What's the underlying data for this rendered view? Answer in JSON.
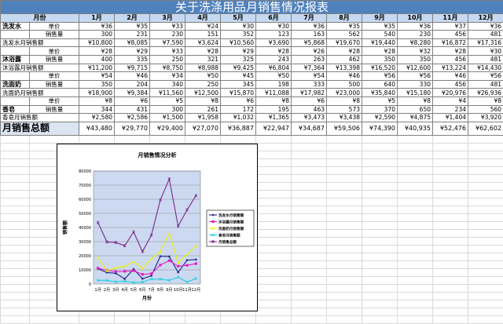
{
  "title": "关于洗涤用品月销售情况报表",
  "header": {
    "category_label": "月份",
    "months": [
      "1月",
      "2月",
      "3月",
      "4月",
      "5月",
      "6月",
      "7月",
      "8月",
      "9月",
      "10月",
      "11月",
      "12月"
    ]
  },
  "rows": [
    {
      "cat": "洗发水",
      "label": "单价",
      "values": [
        "¥36",
        "¥35",
        "¥33",
        "¥24",
        "¥30",
        "¥30",
        "¥36",
        "¥35",
        "¥35",
        "¥36",
        "¥37",
        "¥36"
      ]
    },
    {
      "cat": "",
      "label": "销售量",
      "values": [
        "300",
        "231",
        "230",
        "151",
        "352",
        "123",
        "163",
        "562",
        "540",
        "230",
        "456",
        "481"
      ]
    },
    {
      "cat": "",
      "label": "洗发水月销售额",
      "values": [
        "¥10,800",
        "¥8,085",
        "¥7,590",
        "¥3,624",
        "¥10,560",
        "¥3,690",
        "¥5,868",
        "¥19,670",
        "¥19,440",
        "¥8,280",
        "¥16,872",
        "¥17,316"
      ],
      "full": true
    },
    {
      "cat": "",
      "label": "单价",
      "values": [
        "¥28",
        "¥29",
        "¥33",
        "¥28",
        "¥29",
        "¥28",
        "¥26",
        "¥28",
        "¥28",
        "¥32",
        "¥28",
        "¥30"
      ]
    },
    {
      "cat": "沐浴露",
      "label": "销售量",
      "values": [
        "400",
        "335",
        "250",
        "321",
        "325",
        "243",
        "263",
        "462",
        "350",
        "350",
        "456",
        "481"
      ]
    },
    {
      "cat": "",
      "label": "沐浴露月销售额",
      "values": [
        "¥11,200",
        "¥9,715",
        "¥8,750",
        "¥8,988",
        "¥9,425",
        "¥6,804",
        "¥7,364",
        "¥13,398",
        "¥16,520",
        "¥12,600",
        "¥13,224",
        "¥14,430"
      ],
      "full": true
    },
    {
      "cat": "",
      "label": "单价",
      "values": [
        "¥54",
        "¥46",
        "¥34",
        "¥50",
        "¥45",
        "¥50",
        "¥54",
        "¥46",
        "¥56",
        "¥56",
        "¥46",
        "¥56"
      ]
    },
    {
      "cat": "洗面奶",
      "label": "销售量",
      "values": [
        "350",
        "204",
        "340",
        "250",
        "345",
        "198",
        "333",
        "500",
        "640",
        "330",
        "456",
        "481"
      ]
    },
    {
      "cat": "",
      "label": "洗面奶月销售额",
      "values": [
        "¥18,900",
        "¥9,384",
        "¥11,560",
        "¥12,500",
        "¥15,870",
        "¥11,088",
        "¥17,982",
        "¥23,000",
        "¥35,840",
        "¥15,180",
        "¥20,976",
        "¥26,936"
      ],
      "full": true
    },
    {
      "cat": "",
      "label": "单价",
      "values": [
        "¥8",
        "¥6",
        "¥5",
        "¥8",
        "¥6",
        "¥8",
        "¥6",
        "¥8",
        "¥5",
        "¥8",
        "¥4",
        "¥8"
      ]
    },
    {
      "cat": "香皂",
      "label": "销售量",
      "values": [
        "344",
        "431",
        "300",
        "261",
        "172",
        "195",
        "463",
        "573",
        "370",
        "650",
        "234",
        "560"
      ]
    },
    {
      "cat": "",
      "label": "香皂月销售额",
      "values": [
        "¥2,580",
        "¥2,586",
        "¥1,500",
        "¥1,958",
        "¥1,032",
        "¥1,365",
        "¥3,473",
        "¥3,438",
        "¥2,590",
        "¥4,875",
        "¥1,404",
        "¥3,920"
      ],
      "full": true
    }
  ],
  "total": {
    "label": "月销售总额",
    "values": [
      "¥43,480",
      "¥29,770",
      "¥29,400",
      "¥27,070",
      "¥36,887",
      "¥22,947",
      "¥34,687",
      "¥59,506",
      "¥74,390",
      "¥40,935",
      "¥52,476",
      "¥62,602"
    ]
  },
  "colors": {
    "title_bg": "#4f81bd",
    "header_bg": "#c6d9f1",
    "plot_bg": "#ccd9f0"
  },
  "chart_data": {
    "type": "line",
    "title": "月销售情况分析",
    "xlabel": "月份",
    "ylabel": "销售额",
    "categories": [
      "1月",
      "2月",
      "3月",
      "4月",
      "5月",
      "6月",
      "7月",
      "8月",
      "9月",
      "10月",
      "11月",
      "12月"
    ],
    "ylim": [
      0,
      80000
    ],
    "yticks": [
      0,
      10000,
      20000,
      30000,
      40000,
      50000,
      60000,
      70000,
      80000
    ],
    "grid": true,
    "legend_position": "right",
    "series": [
      {
        "name": "洗发水月销售额",
        "color": "#1f1f8f",
        "marker": "diamond",
        "values": [
          10800,
          8085,
          7590,
          3624,
          10560,
          3690,
          5868,
          19670,
          19440,
          8280,
          16872,
          17316
        ]
      },
      {
        "name": "沐浴露月销售额",
        "color": "#e020c0",
        "marker": "square",
        "values": [
          11200,
          9715,
          8750,
          8988,
          9425,
          6804,
          7364,
          13398,
          16520,
          12600,
          13224,
          14430
        ]
      },
      {
        "name": "洗面奶月销售额",
        "color": "#f0f000",
        "marker": "triangle",
        "values": [
          18900,
          9384,
          11560,
          12500,
          15870,
          11088,
          17982,
          23000,
          35840,
          15180,
          20976,
          26936
        ]
      },
      {
        "name": "香皂月销售额",
        "color": "#20d0e0",
        "marker": "x",
        "values": [
          2580,
          2586,
          1500,
          1958,
          1032,
          1365,
          3473,
          3438,
          2590,
          4875,
          1404,
          3920
        ]
      },
      {
        "name": "月销售总额",
        "color": "#7a2a8a",
        "marker": "star",
        "values": [
          43480,
          29770,
          29400,
          27070,
          36887,
          22947,
          34687,
          59506,
          74390,
          40935,
          52476,
          62602
        ]
      }
    ]
  }
}
